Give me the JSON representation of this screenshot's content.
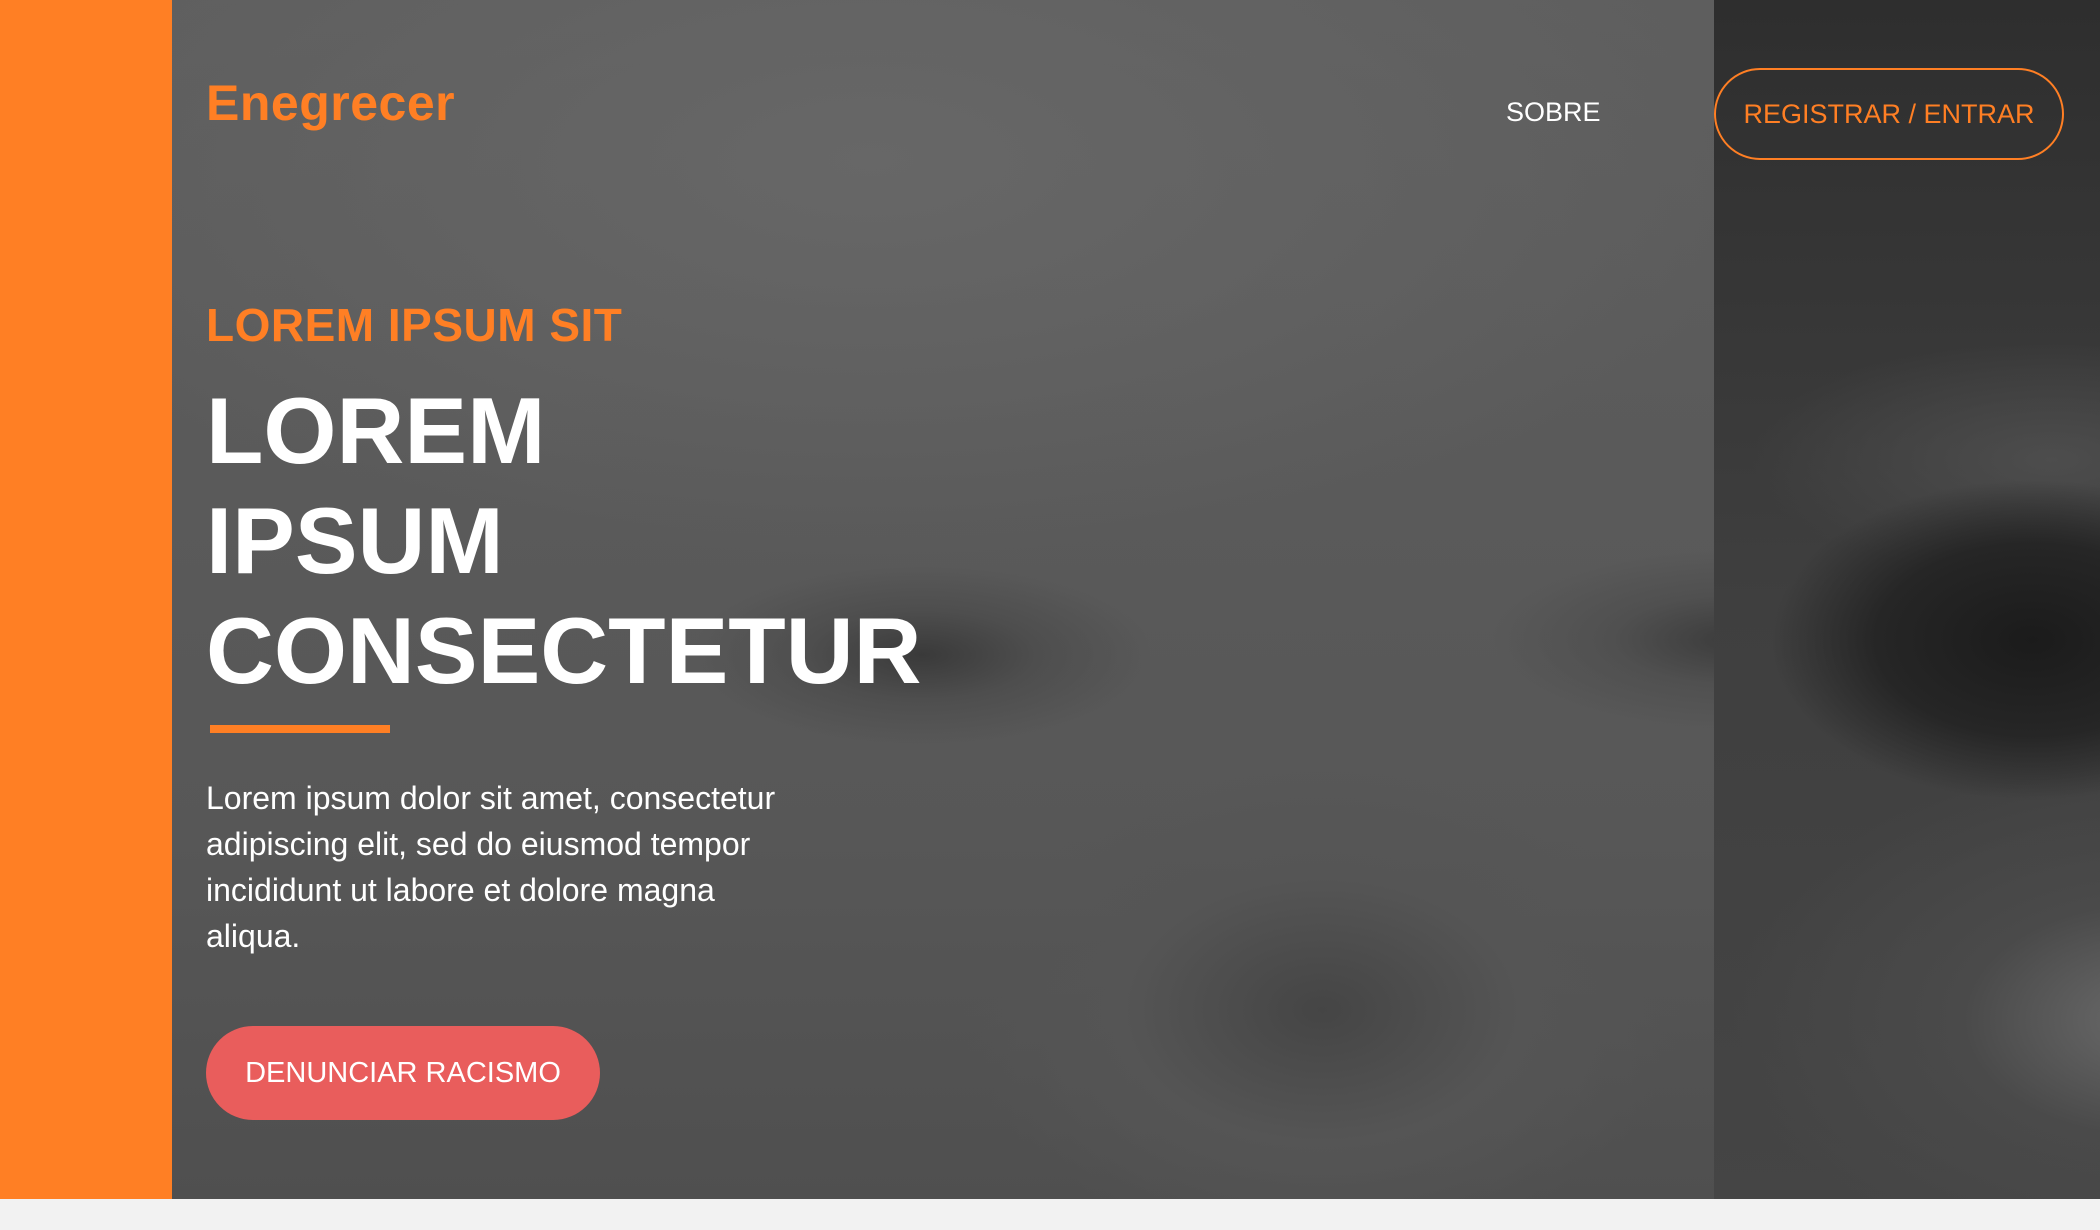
{
  "header": {
    "brand": "Enegrecer",
    "nav_about": "SOBRE",
    "login_label": "REGISTRAR / ENTRAR"
  },
  "hero": {
    "eyebrow": "LOREM IPSUM SIT",
    "headline_lines": [
      "LOREM",
      "IPSUM",
      "CONSECTETUR"
    ],
    "description": "Lorem ipsum dolor sit amet, consectetur adipiscing elit, sed do eiusmod tempor incididunt ut labore et dolore magna aliqua.",
    "cta_label": "DENUNCIAR RACISMO"
  },
  "colors": {
    "accent": "#ff7f24",
    "cta": "#e95d5c",
    "overlay": "#5a5a5a",
    "text": "#ffffff"
  }
}
